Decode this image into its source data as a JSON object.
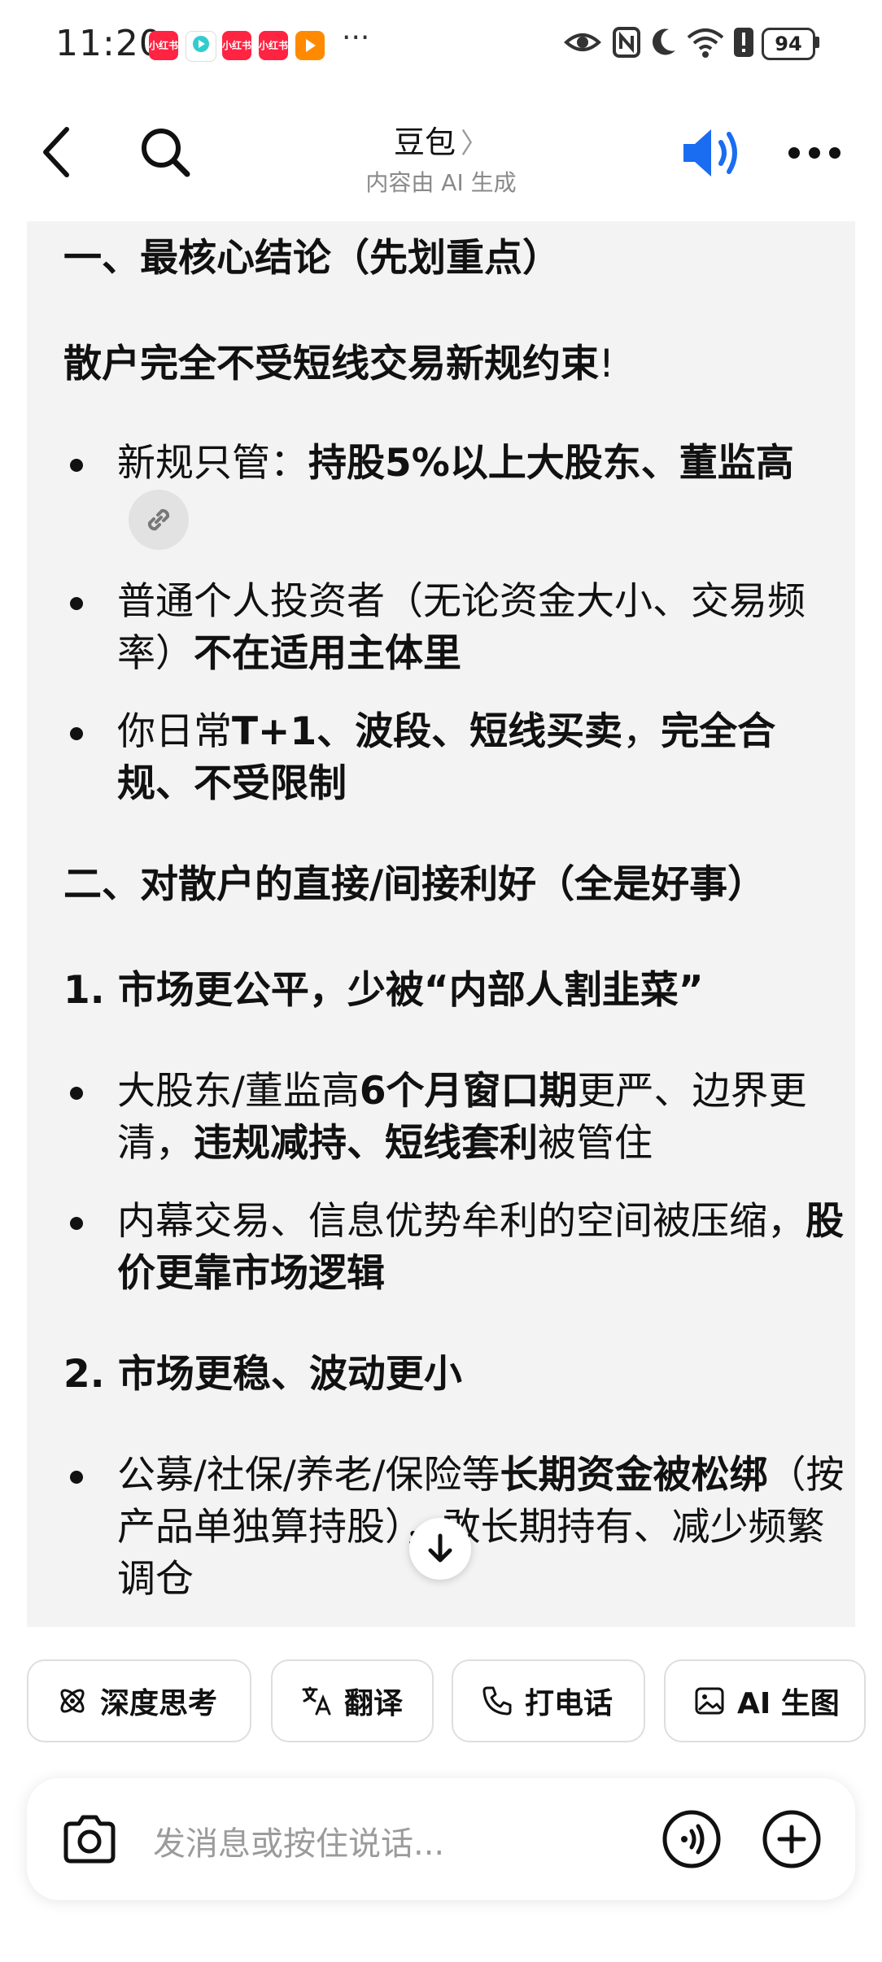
{
  "status_bar": {
    "time": "11:20",
    "notifications": [
      "小红书",
      "",
      "小红书",
      "小红书",
      ""
    ],
    "more": "···",
    "battery": "94"
  },
  "header": {
    "title": "豆包",
    "subtitle": "内容由 AI 生成"
  },
  "message": {
    "section1_title": "一、最核心结论（先划重点）",
    "conclusion_bold": "散户完全不受短线交易新规约束",
    "conclusion_tail": "!",
    "s1_bullets": [
      {
        "pre": "新规只管：",
        "bold": "持股5%以上大股东、董监高"
      },
      {
        "pre": "普通个人投资者（无论资金大小、交易频率）",
        "bold": "不在适用主体里"
      },
      {
        "pre": "你日常",
        "bold1": "T+1、波段、短线买卖",
        "mid": "，",
        "bold2": "完全合规、不受限制"
      }
    ],
    "section2_title": "二、对散户的直接/间接利好（全是好事）",
    "sub1_title": "1. 市场更公平，少被“内部人割韭菜”",
    "sub1_bullets": [
      {
        "pre": "大股东/董监高",
        "bold1": "6个月窗口期",
        "mid": "更严、边界更清，",
        "bold2": "违规减持、短线套利",
        "tail": "被管住"
      },
      {
        "pre": "内幕交易、信息优势牟利的空间被压缩，",
        "bold": "股价更靠市场逻辑"
      }
    ],
    "sub2_title": "2. 市场更稳、波动更小",
    "sub2_bullets": [
      {
        "pre": "公募/社保/养老/保险等",
        "bold": "长期资金被松绑",
        "tail": "（按产品单独算持股），敢长期持有、减少频繁调仓"
      }
    ]
  },
  "quick_actions": [
    {
      "label": "深度思考",
      "icon": "atom-icon"
    },
    {
      "label": "翻译",
      "icon": "translate-icon"
    },
    {
      "label": "打电话",
      "icon": "phone-icon"
    },
    {
      "label": "AI 生图",
      "icon": "image-icon"
    }
  ],
  "input": {
    "placeholder": "发消息或按住说话..."
  },
  "colors": {
    "accent": "#1a6cf0",
    "bubble": "#f3f3f3"
  }
}
